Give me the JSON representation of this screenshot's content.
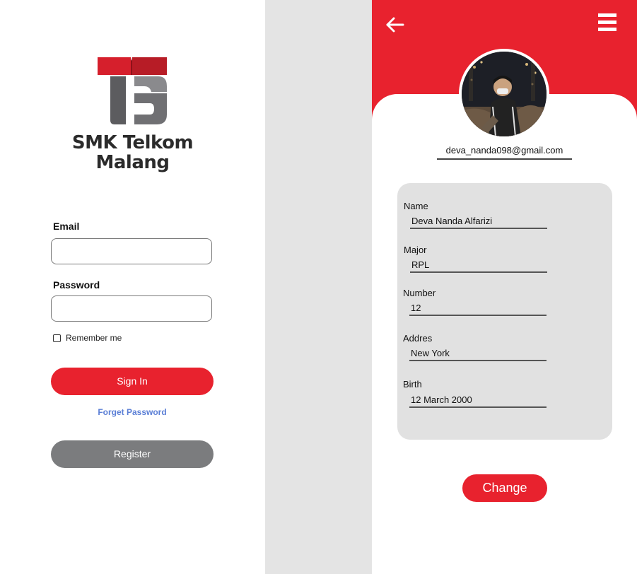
{
  "login": {
    "logo_line1": "SMK Telkom",
    "logo_line2": "Malang",
    "email_label": "Email",
    "email_value": "",
    "password_label": "Password",
    "password_value": "",
    "remember_label": "Remember me",
    "remember_checked": false,
    "signin_label": "Sign In",
    "forget_label": "Forget Password",
    "register_label": "Register"
  },
  "profile": {
    "email": "deva_nanda098@gmail.com",
    "fields": [
      {
        "label": "Name",
        "value": "Deva Nanda Alfarizi"
      },
      {
        "label": "Major",
        "value": "RPL"
      },
      {
        "label": "Number",
        "value": "12"
      },
      {
        "label": "Addres",
        "value": "New York"
      },
      {
        "label": "Birth",
        "value": "12 March 2000"
      }
    ],
    "change_label": "Change"
  },
  "icons": {
    "back": "arrow-left-icon",
    "menu": "hamburger-menu-icon"
  },
  "colors": {
    "brand_red": "#e8222e",
    "register_gray": "#7b7c7e",
    "link_blue": "#5b7fd6",
    "gutter_gray": "#e4e4e4",
    "card_gray": "#e1e1e1"
  }
}
